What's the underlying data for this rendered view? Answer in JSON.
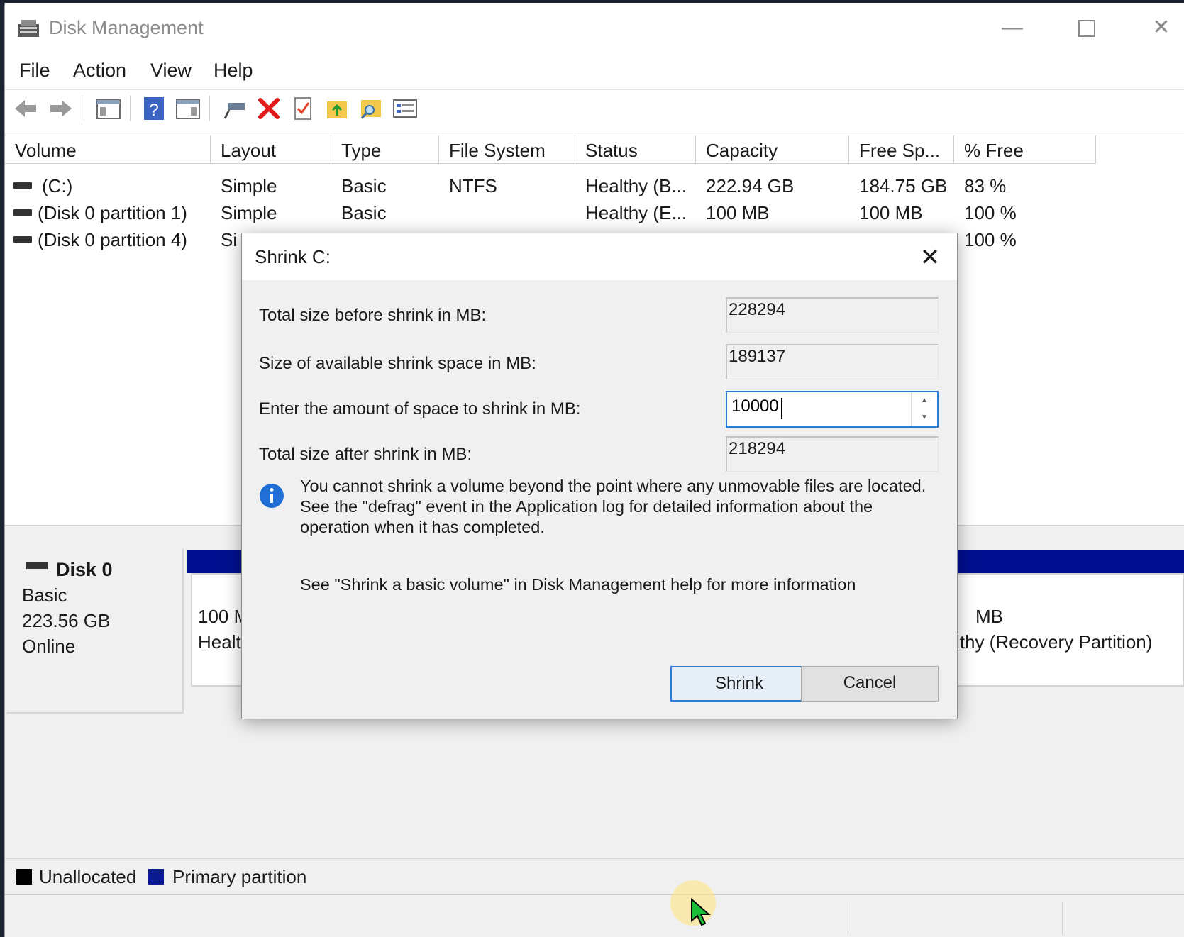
{
  "window": {
    "title": "Disk Management",
    "min_glyph": "—",
    "close_glyph": "✕"
  },
  "menu": [
    "File",
    "Action",
    "View",
    "Help"
  ],
  "volume_list": {
    "columns": [
      "Volume",
      "Layout",
      "Type",
      "File System",
      "Status",
      "Capacity",
      "Free Sp...",
      "% Free"
    ],
    "rows": [
      {
        "volume": "(C:)",
        "layout": "Simple",
        "type": "Basic",
        "fs": "NTFS",
        "status": "Healthy (B...",
        "capacity": "222.94 GB",
        "free": "184.75 GB",
        "pct": "83 %"
      },
      {
        "volume": "(Disk 0 partition 1)",
        "layout": "Simple",
        "type": "Basic",
        "fs": "",
        "status": "Healthy (E...",
        "capacity": "100 MB",
        "free": "100 MB",
        "pct": "100 %"
      },
      {
        "volume": "(Disk 0 partition 4)",
        "layout": "Si",
        "type": "",
        "fs": "",
        "status": "",
        "capacity": "",
        "free": "",
        "pct": "100 %"
      }
    ]
  },
  "disk": {
    "name": "Disk 0",
    "kind": "Basic",
    "size": "223.56 GB",
    "state": "Online",
    "partition_left": {
      "line1": "100 M",
      "line2": "Healt"
    },
    "partition_right": {
      "line1": "MB",
      "line2": "lthy (Recovery Partition)"
    }
  },
  "legend": [
    {
      "label": "Unallocated",
      "color": "#000000"
    },
    {
      "label": "Primary partition",
      "color": "#0a1a8f"
    }
  ],
  "dialog": {
    "title": "Shrink C:",
    "close_glyph": "✕",
    "fields": {
      "total_before_label": "Total size before shrink in MB:",
      "total_before_value": "228294",
      "available_label": "Size of available shrink space in MB:",
      "available_value": "189137",
      "amount_label": "Enter the amount of space to shrink in MB:",
      "amount_value": "10000",
      "total_after_label": "Total size after shrink in MB:",
      "total_after_value": "218294"
    },
    "info_text": "You cannot shrink a volume beyond the point where any unmovable files are located. See the \"defrag\" event in the Application log for detailed information about the operation when it has completed.",
    "help_text": "See \"Shrink a basic volume\" in Disk Management help for more information",
    "buttons": {
      "shrink": "Shrink",
      "cancel": "Cancel"
    }
  },
  "colors": {
    "accent": "#2f7ad3",
    "partition_bar": "#000f8f",
    "close_x": "#e81123"
  }
}
